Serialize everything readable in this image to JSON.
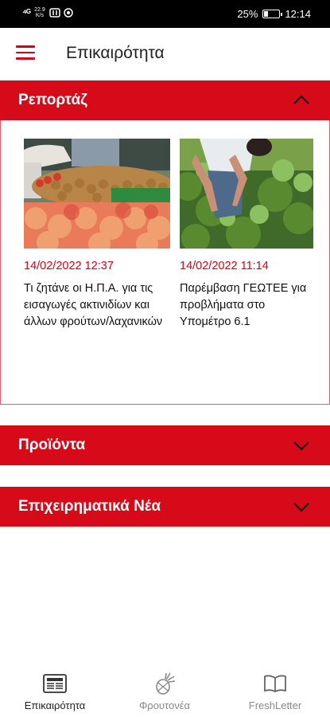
{
  "status_bar": {
    "signal": "⁴ᴳ",
    "speed_value": "22.9",
    "speed_unit": "K/s",
    "battery_percent": "25%",
    "battery_level": 0.25,
    "time": "12:14"
  },
  "app_bar": {
    "menu_icon": "hamburger-menu-icon",
    "title": "Επικαιρότητα"
  },
  "sections": [
    {
      "label": "Ρεπορτάζ",
      "expanded": true,
      "articles": [
        {
          "image": "market-produce-photo",
          "date": "14/02/2022 12:37",
          "title": "Τι ζητάνε οι Η.Π.Α. για τις εισαγωγές ακτινιδίων και άλλων φρούτων/λαχανικών"
        },
        {
          "image": "farmer-in-pepper-field-photo",
          "date": "14/02/2022 11:14",
          "title": "Παρέμβαση ΓΕΩΤΕΕ για προβλήματα στο Υπομέτρο 6.1"
        }
      ]
    },
    {
      "label": "Προϊόντα",
      "expanded": false
    },
    {
      "label": "Επιχειρηματικά Νέα",
      "expanded": false
    }
  ],
  "bottom_nav": {
    "items": [
      {
        "label": "Επικαιρότητα",
        "icon": "newspaper-icon",
        "active": true
      },
      {
        "label": "Φρουτονέα",
        "icon": "pineapple-icon",
        "active": false
      },
      {
        "label": "FreshLetter",
        "icon": "open-book-icon",
        "active": false
      }
    ],
    "active_color": "#222222",
    "inactive_color": "#888888"
  },
  "colors": {
    "accent": "#d70a1a",
    "date": "#d0021b"
  }
}
